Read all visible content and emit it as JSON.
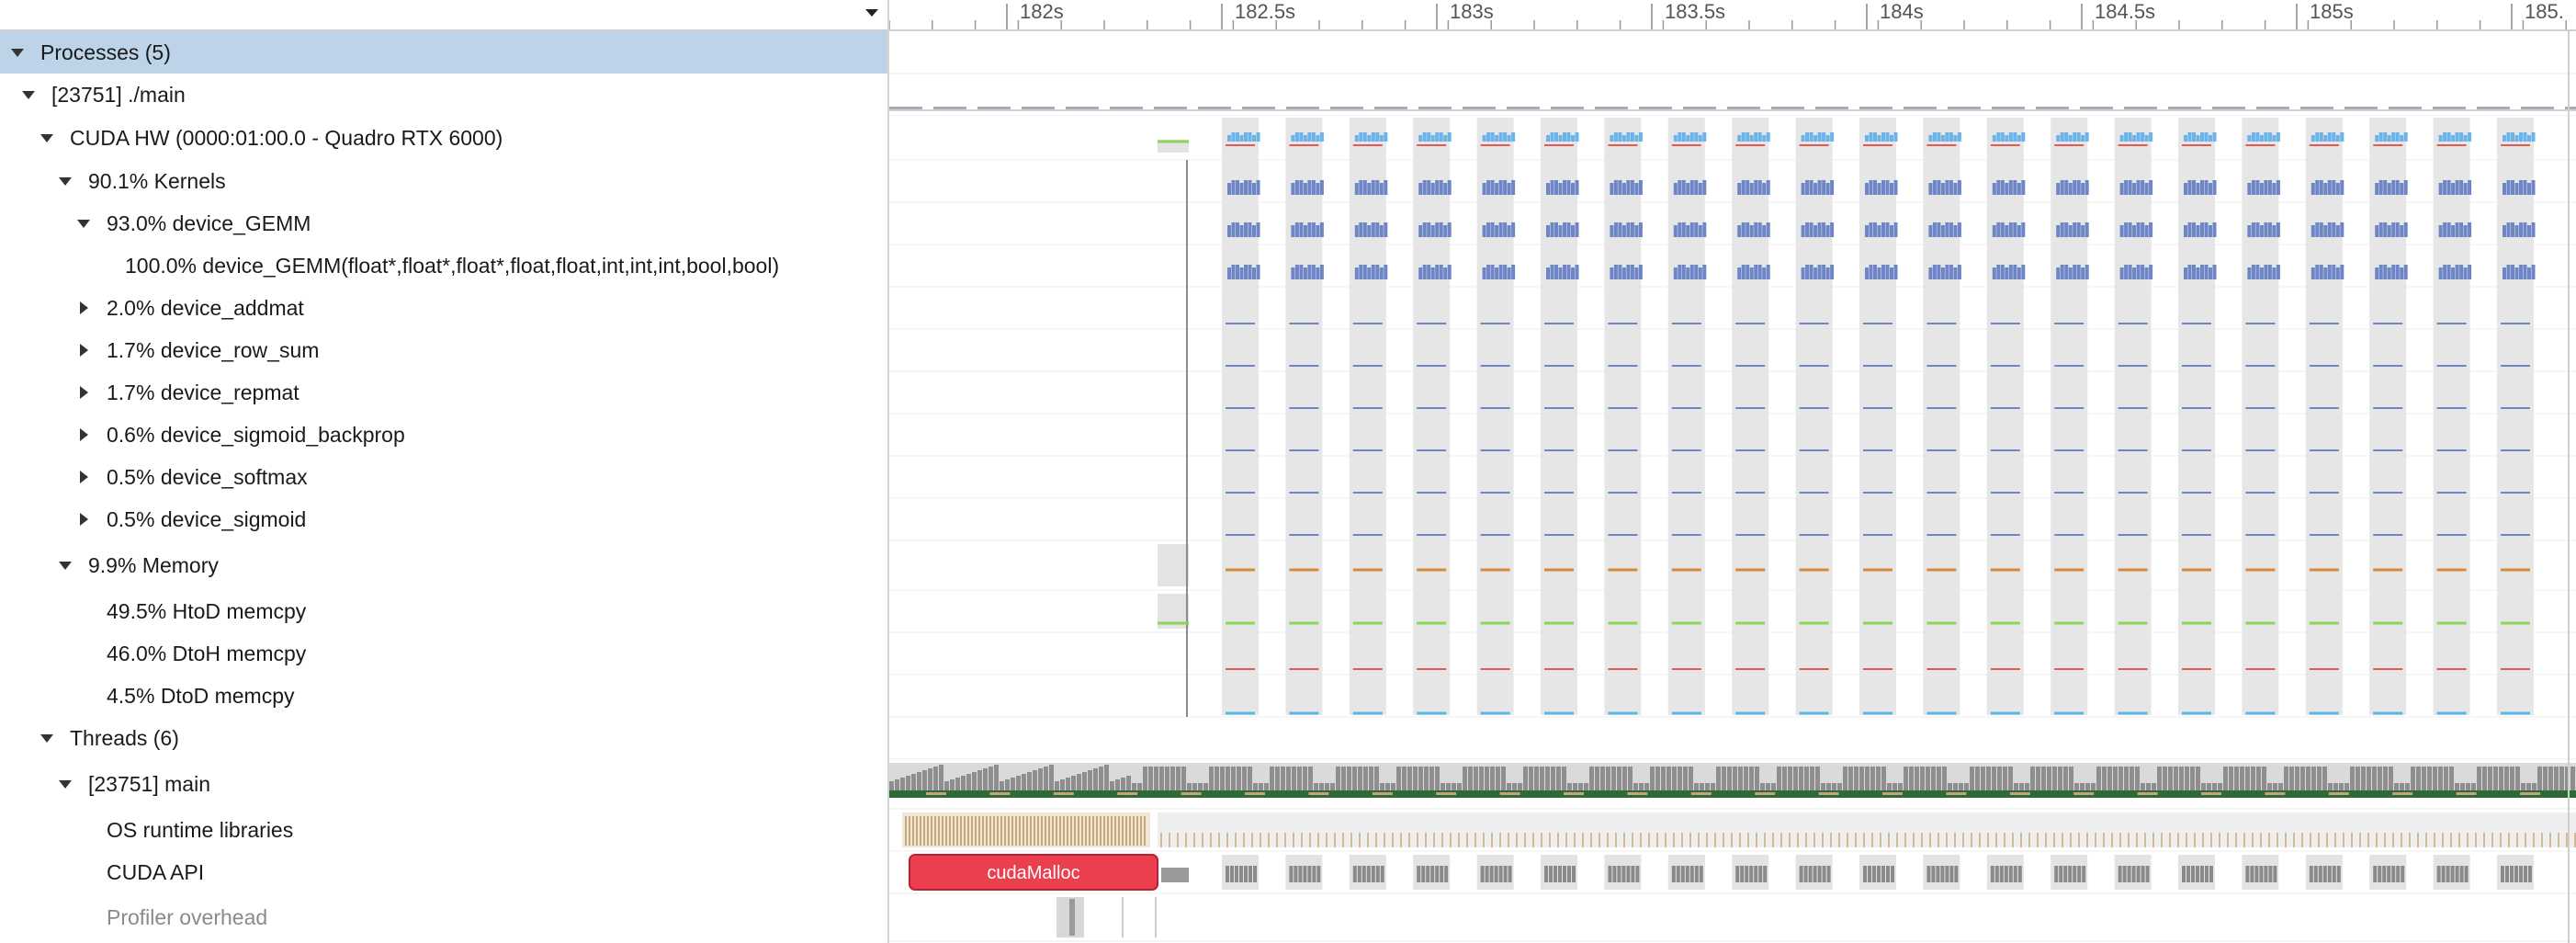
{
  "tree": {
    "rows": [
      {
        "label": "Processes (5)",
        "toggle": "down",
        "selected": true
      },
      {
        "label": "[23751] ./main",
        "toggle": "down"
      },
      {
        "label": "CUDA HW (0000:01:00.0 - Quadro RTX 6000)",
        "toggle": "down"
      },
      {
        "label": "90.1% Kernels",
        "toggle": "down"
      },
      {
        "label": "93.0% device_GEMM",
        "toggle": "down"
      },
      {
        "label": "100.0% device_GEMM(float*,float*,float*,float,float,int,int,int,bool,bool)",
        "toggle": "none"
      },
      {
        "label": "2.0% device_addmat",
        "toggle": "right"
      },
      {
        "label": "1.7% device_row_sum",
        "toggle": "right"
      },
      {
        "label": "1.7% device_repmat",
        "toggle": "right"
      },
      {
        "label": "0.6% device_sigmoid_backprop",
        "toggle": "right"
      },
      {
        "label": "0.5% device_softmax",
        "toggle": "right"
      },
      {
        "label": "0.5% device_sigmoid",
        "toggle": "right"
      },
      {
        "label": "9.9% Memory",
        "toggle": "down"
      },
      {
        "label": "49.5% HtoD memcpy",
        "toggle": "none"
      },
      {
        "label": "46.0% DtoH memcpy",
        "toggle": "none"
      },
      {
        "label": "4.5% DtoD memcpy",
        "toggle": "none"
      },
      {
        "label": "Threads (6)",
        "toggle": "down"
      },
      {
        "label": "[23751] main",
        "toggle": "down"
      },
      {
        "label": "OS runtime libraries",
        "toggle": "none"
      },
      {
        "label": "CUDA API",
        "toggle": "none"
      },
      {
        "label": "Profiler overhead",
        "toggle": "none",
        "dim": true
      }
    ]
  },
  "ruler": {
    "ticks": [
      "182s",
      "182.5s",
      "183s",
      "183.5s",
      "184s",
      "184.5s",
      "185s",
      "185."
    ]
  },
  "timeline": {
    "cuda_api_label": "cudaMalloc"
  },
  "colors": {
    "selection": "#bcd3e8",
    "kernel_blue": "#6f86c6",
    "hw_light_blue": "#6ab4ea",
    "memcpy_orange": "#d6893a",
    "memcpy_green": "#8ad65a",
    "memcpy_red": "#e05a5a",
    "memcpy_cyan": "#5ab8e8",
    "thread_green": "#2e6a35",
    "os_runtime_tan": "#c9aa79",
    "cuda_malloc_red": "#ec3f4d"
  }
}
